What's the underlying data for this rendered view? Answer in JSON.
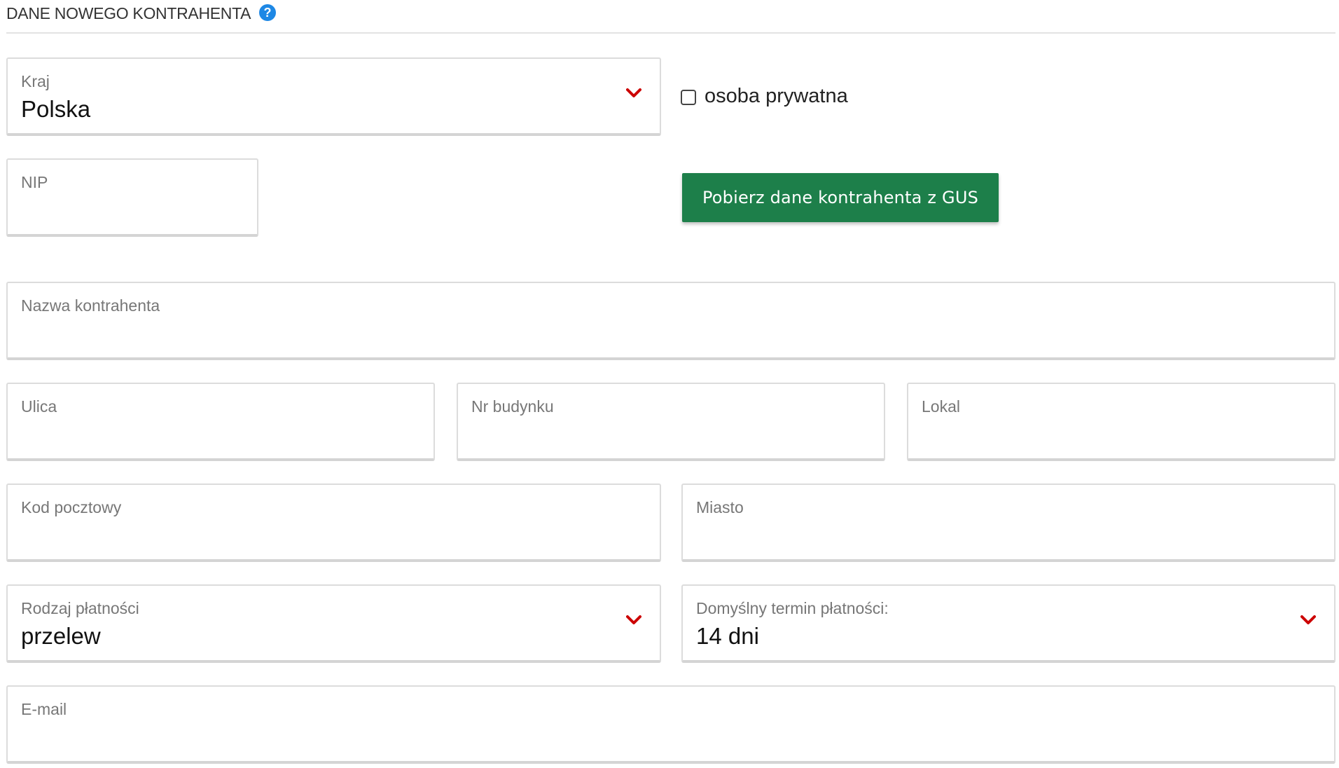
{
  "section": {
    "title": "DANE NOWEGO KONTRAHENTA",
    "help_icon": "?"
  },
  "fields": {
    "country": {
      "label": "Kraj",
      "value": "Polska"
    },
    "private_person": {
      "label": "osoba prywatna",
      "checked": false
    },
    "nip": {
      "label": "NIP",
      "value": ""
    },
    "gus_button": {
      "label": "Pobierz dane kontrahenta z GUS"
    },
    "name": {
      "label": "Nazwa kontrahenta",
      "value": ""
    },
    "street": {
      "label": "Ulica",
      "value": ""
    },
    "building": {
      "label": "Nr budynku",
      "value": ""
    },
    "unit": {
      "label": "Lokal",
      "value": ""
    },
    "postal": {
      "label": "Kod pocztowy",
      "value": ""
    },
    "city": {
      "label": "Miasto",
      "value": ""
    },
    "payment_type": {
      "label": "Rodzaj płatności",
      "value": "przelew"
    },
    "payment_term": {
      "label": "Domyślny termin płatności:",
      "value": "14 dni"
    },
    "email": {
      "label": "E-mail",
      "value": ""
    }
  },
  "colors": {
    "button_green": "#1d7f4a",
    "chevron_red": "#cc0000",
    "help_blue": "#1e88e5"
  }
}
